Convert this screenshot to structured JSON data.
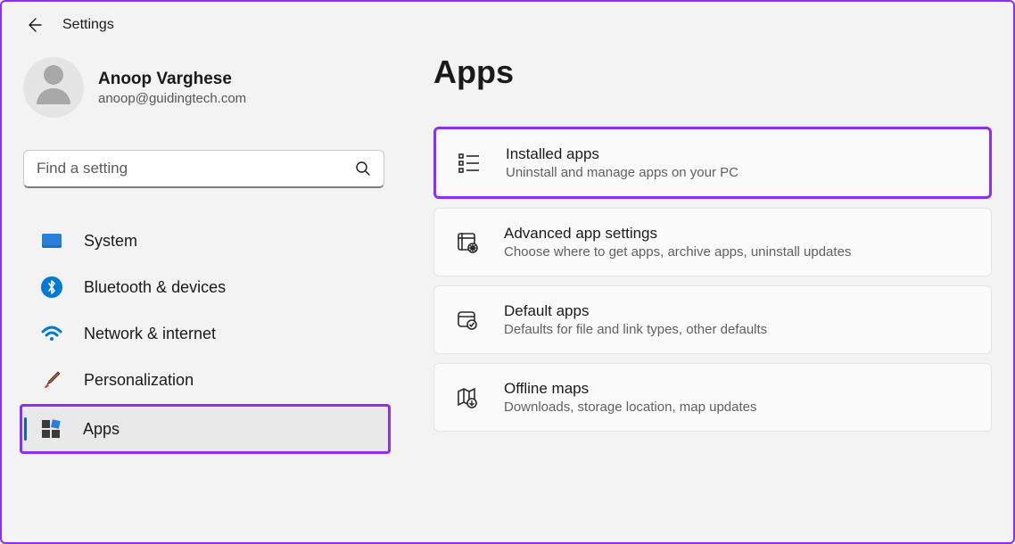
{
  "header": {
    "title": "Settings"
  },
  "profile": {
    "name": "Anoop Varghese",
    "email": "anoop@guidingtech.com"
  },
  "search": {
    "placeholder": "Find a setting"
  },
  "sidebar": {
    "items": [
      {
        "label": "System",
        "icon": "system-icon"
      },
      {
        "label": "Bluetooth & devices",
        "icon": "bluetooth-icon"
      },
      {
        "label": "Network & internet",
        "icon": "wifi-icon"
      },
      {
        "label": "Personalization",
        "icon": "brush-icon"
      },
      {
        "label": "Apps",
        "icon": "apps-icon",
        "selected": true
      }
    ]
  },
  "main": {
    "title": "Apps",
    "cards": [
      {
        "title": "Installed apps",
        "subtitle": "Uninstall and manage apps on your PC",
        "icon": "installed-apps-icon",
        "highlighted": true
      },
      {
        "title": "Advanced app settings",
        "subtitle": "Choose where to get apps, archive apps, uninstall updates",
        "icon": "advanced-settings-icon"
      },
      {
        "title": "Default apps",
        "subtitle": "Defaults for file and link types, other defaults",
        "icon": "default-apps-icon"
      },
      {
        "title": "Offline maps",
        "subtitle": "Downloads, storage location, map updates",
        "icon": "offline-maps-icon"
      }
    ]
  },
  "colors": {
    "accent": "#0067c0",
    "highlight": "#8b2ff5"
  }
}
